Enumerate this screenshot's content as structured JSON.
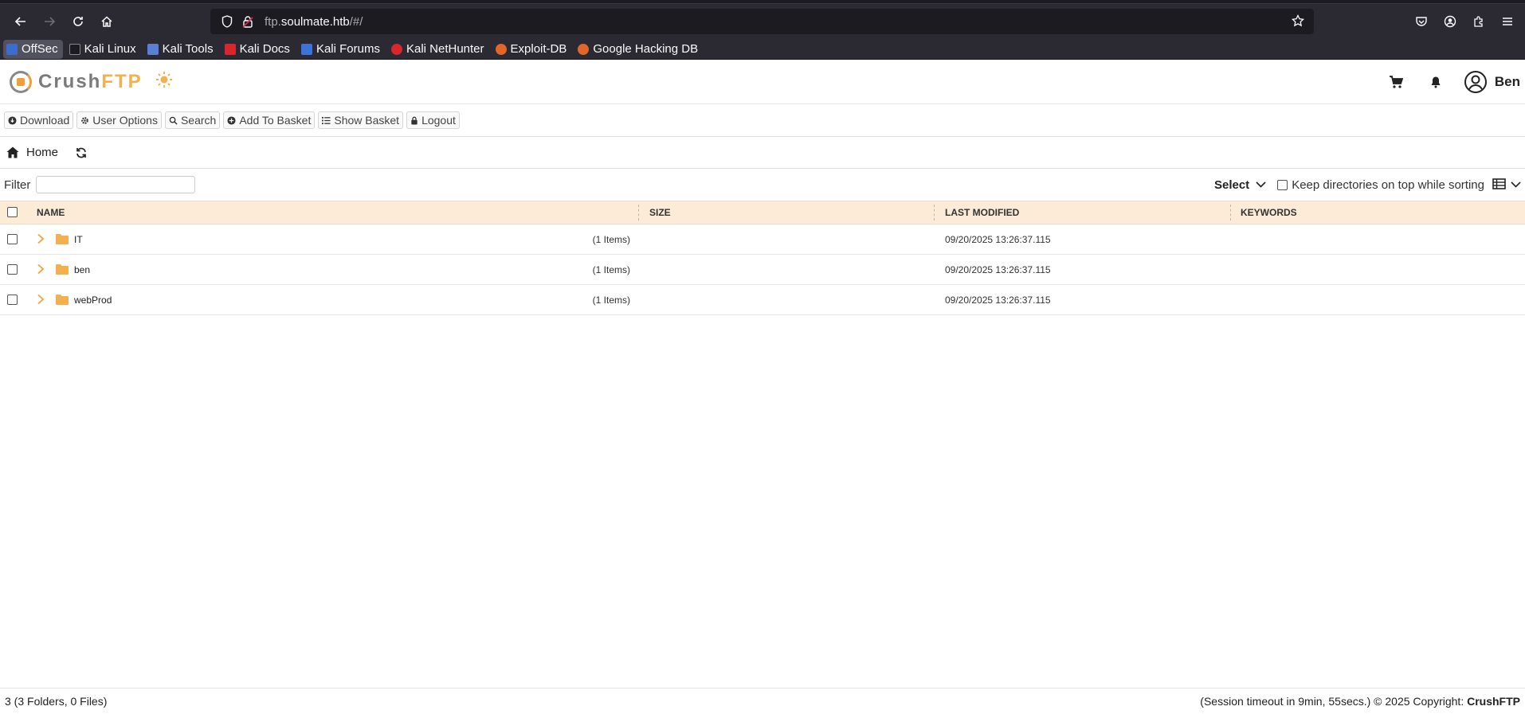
{
  "browser": {
    "url_host": "ftp.soulmate.htb",
    "url_prefix": "ftp.",
    "url_domain": "soulmate.htb",
    "url_path": "/#/",
    "bookmarks": [
      {
        "label": "OffSec",
        "color": "#3d6dcc"
      },
      {
        "label": "Kali Linux",
        "color": "#2b2a33"
      },
      {
        "label": "Kali Tools",
        "color": "#5a7fd6"
      },
      {
        "label": "Kali Docs",
        "color": "#d9262c"
      },
      {
        "label": "Kali Forums",
        "color": "#3b73d9"
      },
      {
        "label": "Kali NetHunter",
        "color": "#d9262c"
      },
      {
        "label": "Exploit-DB",
        "color": "#e0662a"
      },
      {
        "label": "Google Hacking DB",
        "color": "#e0662a"
      }
    ]
  },
  "app": {
    "logo_part1": "Crush",
    "logo_part2": "FTP",
    "user_name": "Ben"
  },
  "toolbar": {
    "download": "Download",
    "user_options": "User Options",
    "search": "Search",
    "add_to_basket": "Add To Basket",
    "show_basket": "Show Basket",
    "logout": "Logout"
  },
  "breadcrumb": {
    "home": "Home"
  },
  "filter": {
    "label": "Filter",
    "value": "",
    "select_label": "Select",
    "keep_dirs_label": "Keep directories on top while sorting"
  },
  "table": {
    "columns": {
      "name": "NAME",
      "size": "SIZE",
      "last_modified": "LAST MODIFIED",
      "keywords": "KEYWORDS"
    },
    "rows": [
      {
        "name": "IT",
        "size": "(1 Items)",
        "modified": "09/20/2025 13:26:37.115"
      },
      {
        "name": "ben",
        "size": "(1 Items)",
        "modified": "09/20/2025 13:26:37.115"
      },
      {
        "name": "webProd",
        "size": "(1 Items)",
        "modified": "09/20/2025 13:26:37.115"
      }
    ]
  },
  "footer": {
    "summary": "3 (3 Folders, 0 Files)",
    "session": "(Session timeout in 9min, 55secs.) © 2025 Copyright: ",
    "brand": "CrushFTP"
  },
  "colors": {
    "accent": "#f3b04e",
    "table_header_bg": "#fcebd7",
    "folder": "#f3b04e"
  }
}
